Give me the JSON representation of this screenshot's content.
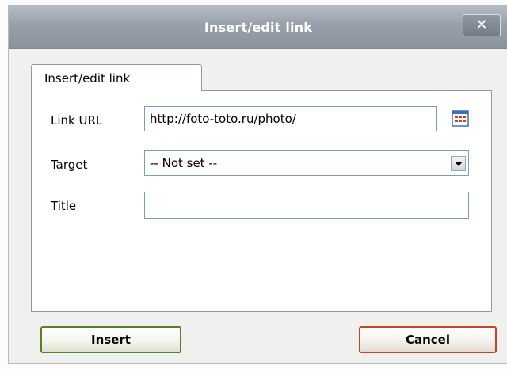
{
  "dialog": {
    "title": "Insert/edit link",
    "close_symbol": "✕"
  },
  "tabs": [
    {
      "label": "Insert/edit link",
      "selected": true
    }
  ],
  "form": {
    "link_url": {
      "label": "Link URL",
      "value": "http://foto-toto.ru/photo/",
      "browse_icon": "browse-calendar-icon"
    },
    "target": {
      "label": "Target",
      "selected": "-- Not set --"
    },
    "title": {
      "label": "Title",
      "value": ""
    }
  },
  "buttons": {
    "insert_label": "Insert",
    "cancel_label": "Cancel"
  },
  "colors": {
    "titlebar": "#98a1ab",
    "insert_border": "#5b7f29",
    "cancel_border": "#c2452a",
    "field_border": "#7f9db9"
  }
}
